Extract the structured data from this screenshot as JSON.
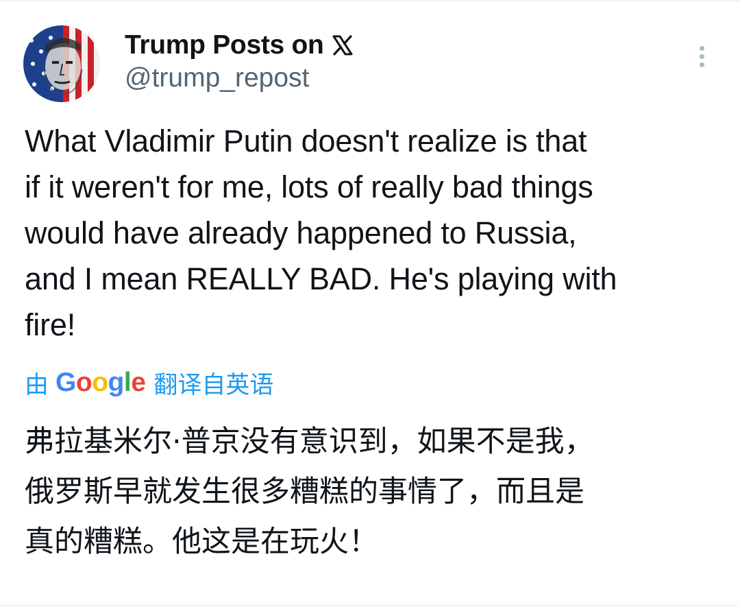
{
  "account": {
    "display_name": "Trump Posts on",
    "x_logo_icon": "x-logo-icon",
    "handle": "@trump_repost",
    "avatar_icon": "flag-portrait-avatar"
  },
  "tweet": {
    "text": "What Vladimir Putin doesn't realize is that\nif it weren't for me, lots of really bad things\nwould have already happened to Russia,\nand I mean REALLY BAD. He's playing with\nfire!"
  },
  "translation": {
    "prefix": "由",
    "google_letters": [
      "G",
      "o",
      "o",
      "g",
      "l",
      "e"
    ],
    "suffix": "翻译自英语",
    "text": "弗拉基米尔·普京没有意识到，如果不是我，\n俄罗斯早就发生很多糟糕的事情了，而且是\n真的糟糕。他这是在玩火！"
  },
  "more_menu_icon": "more-vertical-icon",
  "colors": {
    "link_blue": "#1d9bf0",
    "secondary_text": "#536471",
    "primary_text": "#0f1419",
    "google_blue": "#4285f4",
    "google_red": "#ea4335",
    "google_yellow": "#fbbc05",
    "google_green": "#34a853"
  }
}
